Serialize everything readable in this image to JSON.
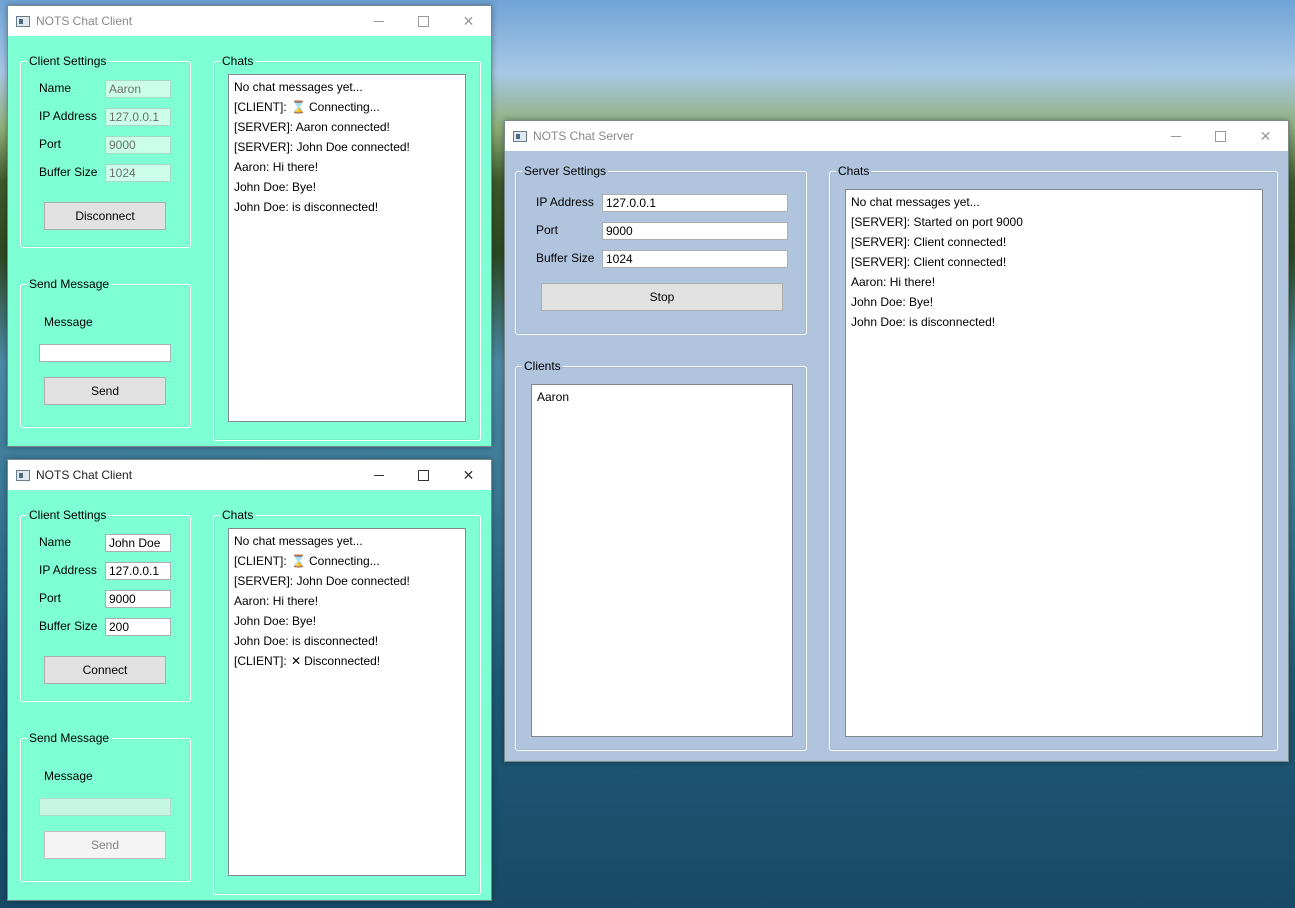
{
  "client1": {
    "title": "NOTS Chat Client",
    "settings_label": "Client Settings",
    "name_label": "Name",
    "name_value": "Aaron",
    "ip_label": "IP Address",
    "ip_value": "127.0.0.1",
    "port_label": "Port",
    "port_value": "9000",
    "buffer_label": "Buffer Size",
    "buffer_value": "1024",
    "connect_button": "Disconnect",
    "send_group_label": "Send Message",
    "message_label": "Message",
    "message_value": "",
    "send_button": "Send",
    "chats_label": "Chats",
    "chats": [
      {
        "text": "No chat messages yet..."
      },
      {
        "prefix": "[CLIENT]:",
        "icon": "hourglass-icon",
        "glyph": "⌛",
        "text": "Connecting..."
      },
      {
        "text": "[SERVER]: Aaron connected!"
      },
      {
        "text": "[SERVER]: John Doe connected!"
      },
      {
        "text": "Aaron: Hi there!"
      },
      {
        "text": "John Doe: Bye!"
      },
      {
        "text": "John Doe: is disconnected!"
      }
    ]
  },
  "client2": {
    "title": "NOTS Chat Client",
    "settings_label": "Client Settings",
    "name_label": "Name",
    "name_value": "John Doe",
    "ip_label": "IP Address",
    "ip_value": "127.0.0.1",
    "port_label": "Port",
    "port_value": "9000",
    "buffer_label": "Buffer Size",
    "buffer_value": "200",
    "connect_button": "Connect",
    "send_group_label": "Send Message",
    "message_label": "Message",
    "message_value": "",
    "send_button": "Send",
    "chats_label": "Chats",
    "chats": [
      {
        "text": "No chat messages yet..."
      },
      {
        "prefix": "[CLIENT]:",
        "icon": "hourglass-icon",
        "glyph": "⌛",
        "text": "Connecting..."
      },
      {
        "text": "[SERVER]: John Doe connected!"
      },
      {
        "text": "Aaron: Hi there!"
      },
      {
        "text": "John Doe: Bye!"
      },
      {
        "text": "John Doe: is disconnected!"
      },
      {
        "prefix": "[CLIENT]:",
        "icon": "cross-icon",
        "glyph": "✕",
        "text": "Disconnected!"
      }
    ]
  },
  "server": {
    "title": "NOTS Chat Server",
    "settings_label": "Server Settings",
    "ip_label": "IP Address",
    "ip_value": "127.0.0.1",
    "port_label": "Port",
    "port_value": "9000",
    "buffer_label": "Buffer Size",
    "buffer_value": "1024",
    "stop_button": "Stop",
    "clients_label": "Clients",
    "clients": [
      "Aaron"
    ],
    "chats_label": "Chats",
    "chats": [
      {
        "text": "No chat messages yet..."
      },
      {
        "text": "[SERVER]: Started on port 9000"
      },
      {
        "text": "[SERVER]: Client connected!"
      },
      {
        "text": "[SERVER]: Client connected!"
      },
      {
        "text": "Aaron: Hi there!"
      },
      {
        "text": "John Doe: Bye!"
      },
      {
        "text": "John Doe: is disconnected!"
      }
    ]
  },
  "colors": {
    "client_background": "#7fffd4",
    "server_background": "#b0c4de"
  }
}
